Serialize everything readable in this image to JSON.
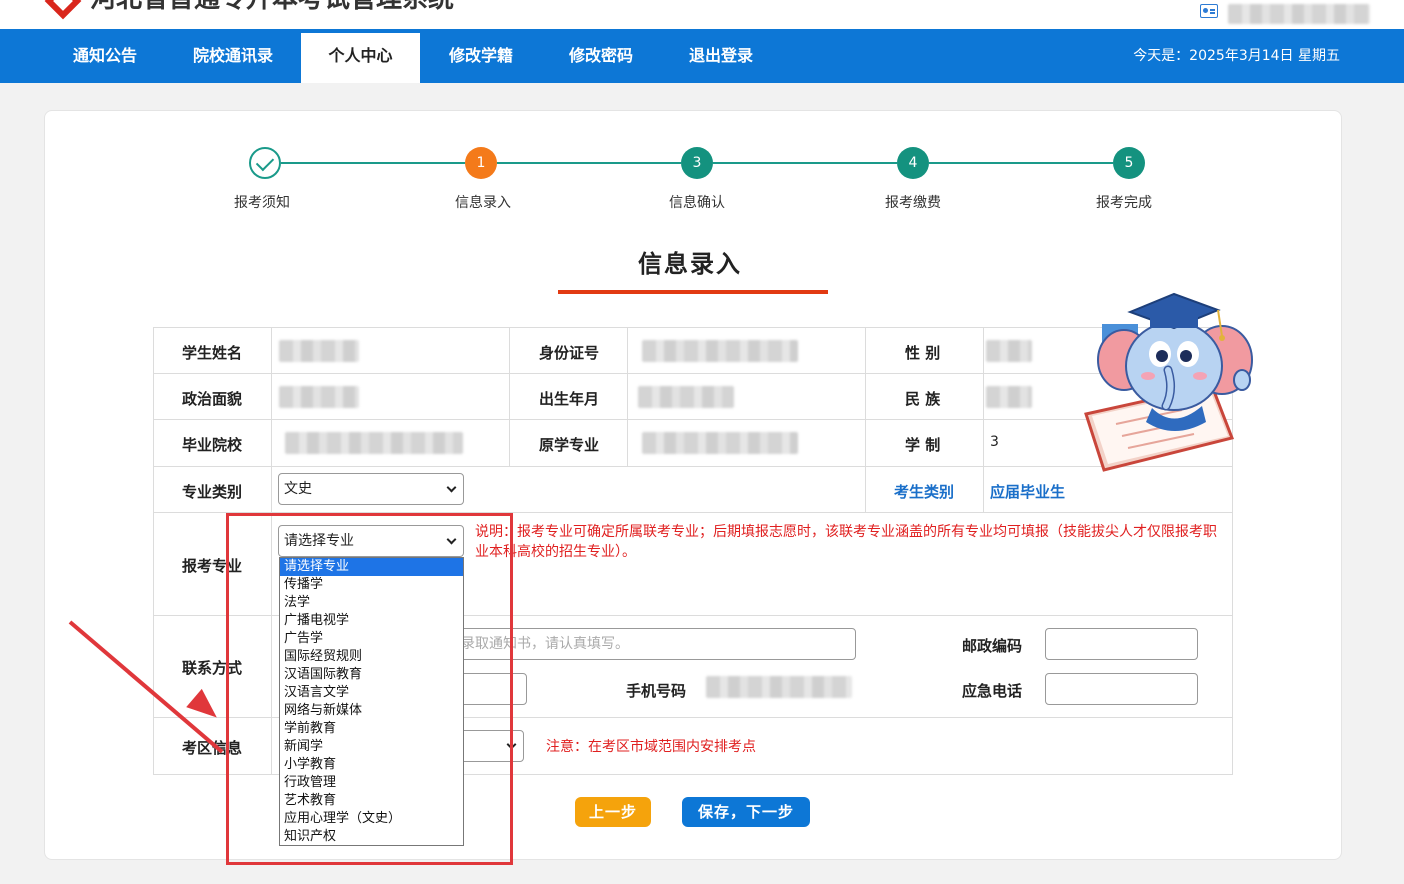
{
  "header": {
    "site_title": "河北省普通专升本考试管理系统"
  },
  "nav": {
    "items": [
      {
        "label": "通知公告"
      },
      {
        "label": "院校通讯录"
      },
      {
        "label": "个人中心"
      },
      {
        "label": "修改学籍"
      },
      {
        "label": "修改密码"
      },
      {
        "label": "退出登录"
      }
    ],
    "active_index": 2,
    "date_text": "今天是：2025年3月14日 星期五"
  },
  "steps": [
    {
      "label": "报考须知",
      "number": "",
      "state": "done"
    },
    {
      "label": "信息录入",
      "number": "1",
      "state": "current"
    },
    {
      "label": "信息确认",
      "number": "3",
      "state": "todo"
    },
    {
      "label": "报考缴费",
      "number": "4",
      "state": "todo"
    },
    {
      "label": "报考完成",
      "number": "5",
      "state": "todo"
    }
  ],
  "section_title": "信息录入",
  "form": {
    "student_name_label": "学生姓名",
    "id_number_label": "身份证号",
    "gender_label": "性 别",
    "political_status_label": "政治面貌",
    "birth_label": "出生年月",
    "ethnicity_label": "民 族",
    "graduate_school_label": "毕业院校",
    "original_major_label": "原学专业",
    "schooling_label": "学 制",
    "schooling_value": "3",
    "major_category_label": "专业类别",
    "major_category_value": "文史",
    "candidate_type_label": "考生类别",
    "candidate_type_value": "应届毕业生",
    "apply_major_label": "报考专业",
    "apply_major_value": "请选择专业",
    "apply_major_note": "说明：报考专业可确定所属联考专业；后期填报志愿时，该联考专业涵盖的所有专业均可填报（技能拔尖人才仅限报考职业本科高校的招生专业）。",
    "contact_label": "联系方式",
    "address_placeholder": "录取通知书，请认真填写。",
    "postal_code_label": "邮政编码",
    "mobile_label": "手机号码",
    "emergency_phone_label": "应急电话",
    "exam_area_label": "考区信息",
    "exam_area_note": "注意：在考区市域范围内安排考点"
  },
  "dropdown": {
    "options": [
      "请选择专业",
      "传播学",
      "法学",
      "广播电视学",
      "广告学",
      "国际经贸规则",
      "汉语国际教育",
      "汉语言文学",
      "网络与新媒体",
      "学前教育",
      "新闻学",
      "小学教育",
      "行政管理",
      "艺术教育",
      "应用心理学（文史）",
      "知识产权"
    ],
    "selected_index": 0
  },
  "buttons": {
    "prev_label": "上一步",
    "next_label": "保存，下一步"
  },
  "colors": {
    "nav_blue": "#0d77d6",
    "step_teal": "#14927f",
    "step_current": "#f47a1a",
    "title_underline": "#e23a12",
    "note_red": "#e02020",
    "prev_button": "#f5a30c",
    "next_button": "#0d77d6",
    "annotation_red": "#e0373b"
  }
}
